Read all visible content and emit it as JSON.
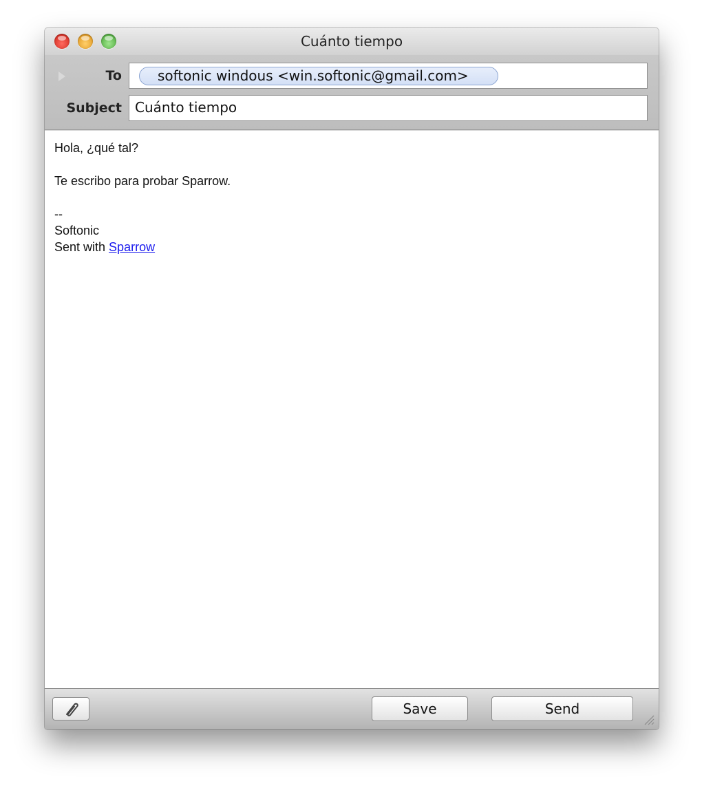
{
  "window": {
    "title": "Cuánto tiempo"
  },
  "compose": {
    "to_label": "To",
    "subject_label": "Subject",
    "recipient": "softonic windous <win.softonic@gmail.com>",
    "subject_value": "Cuánto tiempo"
  },
  "body": {
    "greeting": "Hola, ¿qué tal?",
    "message": "Te escribo para probar Sparrow.",
    "sig_separator": "--",
    "sig_name": "Softonic",
    "sent_with_prefix": "Sent with ",
    "sent_with_link": "Sparrow"
  },
  "toolbar": {
    "save_label": "Save",
    "send_label": "Send",
    "attach_icon": "paperclip-icon"
  },
  "colors": {
    "link": "#1a1aee",
    "token_fill": "#d4e0f6",
    "token_border": "#8aa3d1"
  }
}
